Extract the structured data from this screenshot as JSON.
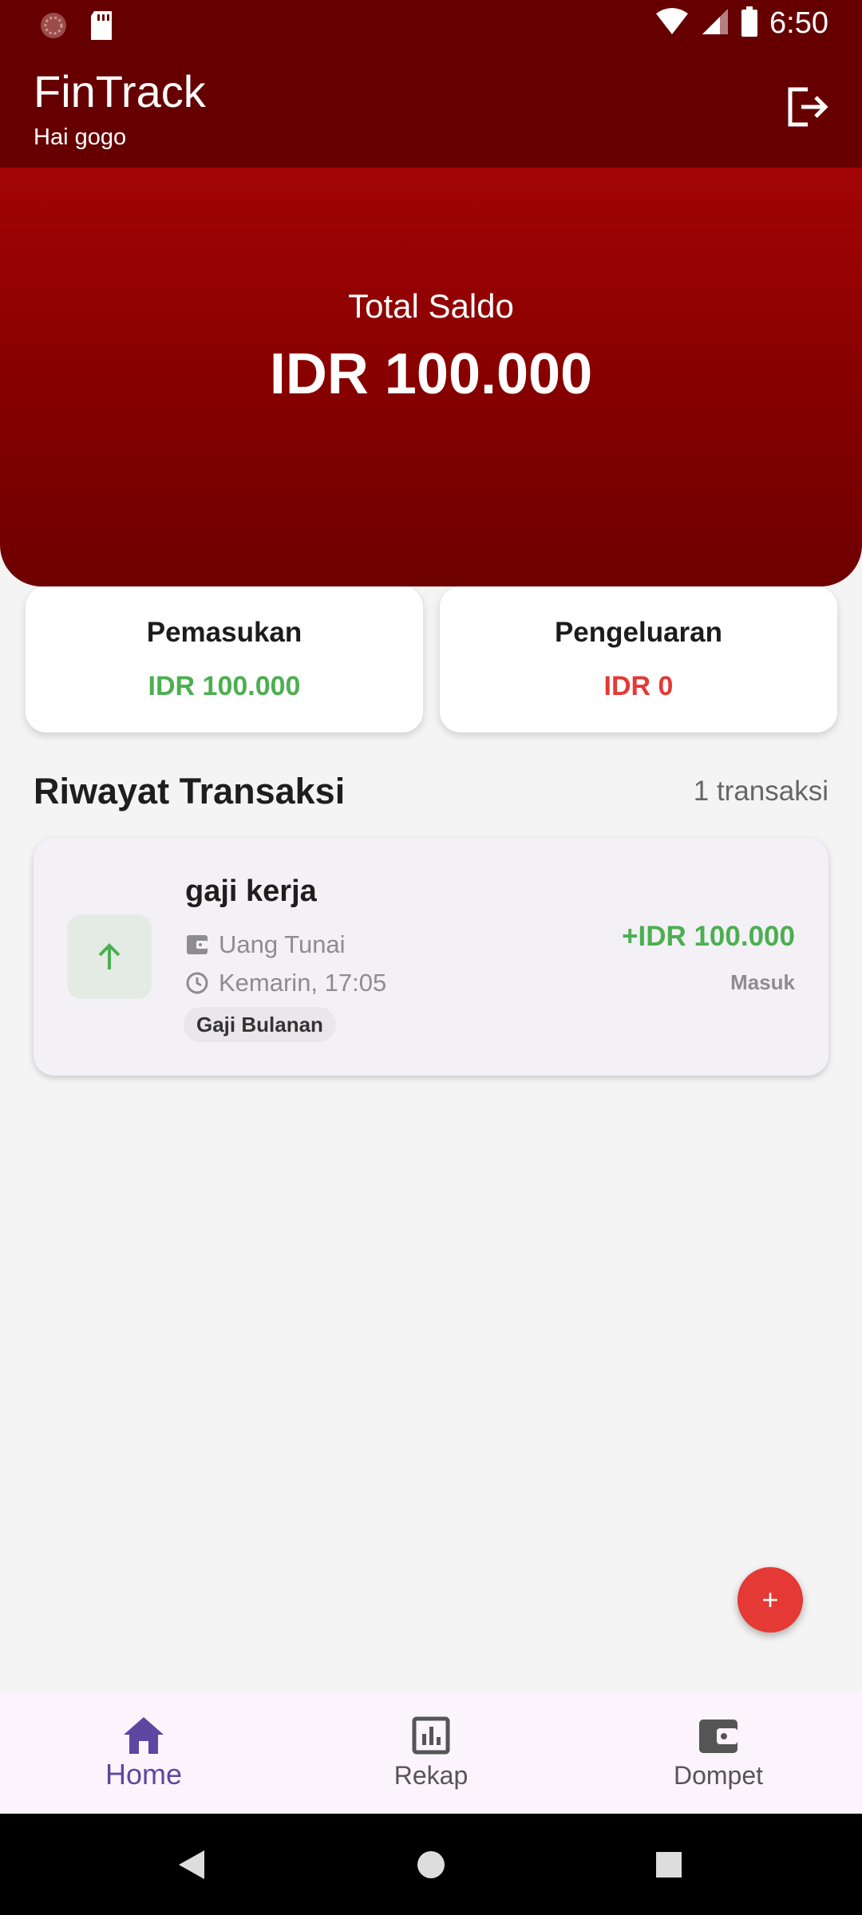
{
  "status_bar": {
    "time": "6:50"
  },
  "app_bar": {
    "title": "FinTrack",
    "greeting": "Hai gogo"
  },
  "balance": {
    "label": "Total Saldo",
    "value": "IDR 100.000"
  },
  "summary": {
    "income_title": "Pemasukan",
    "income_value": "IDR 100.000",
    "expense_title": "Pengeluaran",
    "expense_value": "IDR 0"
  },
  "history": {
    "title": "Riwayat Transaksi",
    "count": "1 transaksi",
    "items": [
      {
        "name": "gaji kerja",
        "wallet": "Uang Tunai",
        "time": "Kemarin, 17:05",
        "category": "Gaji Bulanan",
        "amount": "+IDR 100.000",
        "type": "Masuk"
      }
    ]
  },
  "fab": {
    "label": "+"
  },
  "bottom_nav": {
    "items": [
      {
        "label": "Home",
        "icon": "home-icon"
      },
      {
        "label": "Rekap",
        "icon": "chart-icon"
      },
      {
        "label": "Dompet",
        "icon": "wallet-icon"
      }
    ]
  },
  "colors": {
    "primary": "#660000",
    "income": "#4caf50",
    "expense": "#e53935",
    "nav_active": "#5c48a0"
  }
}
